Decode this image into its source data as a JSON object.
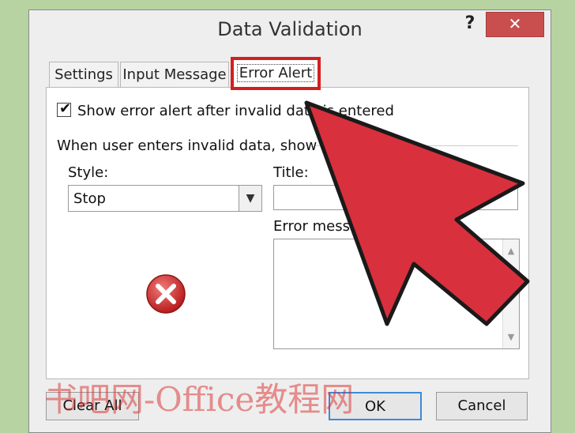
{
  "dialog": {
    "title": "Data Validation",
    "help_label": "?",
    "close_label": "✕"
  },
  "tabs": [
    {
      "label": "Settings"
    },
    {
      "label": "Input Message"
    },
    {
      "label": "Error Alert",
      "active": true
    }
  ],
  "error_alert": {
    "show_checkbox_label": "Show error alert after invalid data is entered",
    "show_checkbox_checked": true,
    "info_text": "When user enters invalid data, show this e",
    "style_label": "Style:",
    "style_value": "Stop",
    "title_label": "Title:",
    "title_value": "",
    "message_label": "Error messag",
    "message_value": ""
  },
  "buttons": {
    "clear_all": "Clear All",
    "ok": "OK",
    "cancel": "Cancel"
  },
  "watermark": "书吧网-Office教程网",
  "colors": {
    "background": "#b6d3a1",
    "close_button": "#c94f4f",
    "highlight": "#d41f1f",
    "arrow": "#d9303d"
  },
  "icons": [
    "stop-error-icon",
    "dropdown-arrow-icon",
    "checkbox-check-icon",
    "pointer-arrow-annotation"
  ]
}
